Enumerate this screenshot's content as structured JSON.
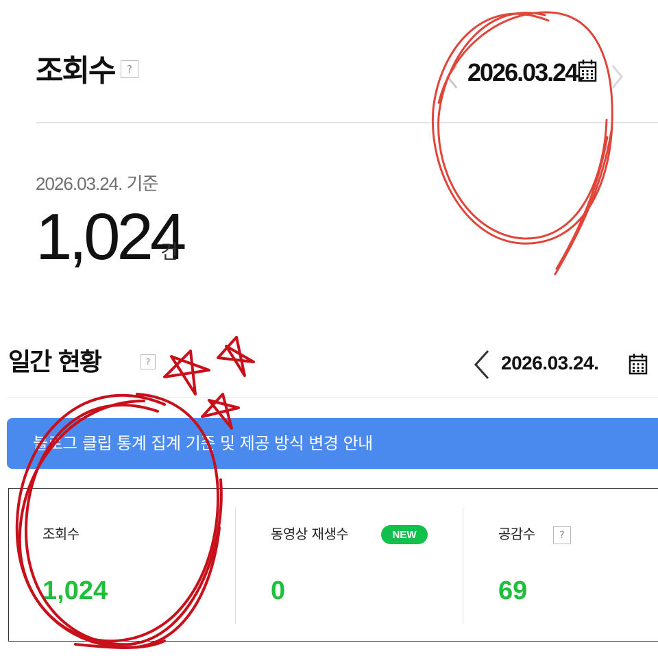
{
  "views_section": {
    "title": "조회수",
    "help_glyph": "?",
    "date": "2026.03.24.",
    "prev_icon": "chevron-left-icon",
    "next_icon": "chevron-right-icon",
    "calendar_icon": "calendar-icon",
    "basis_text": "2026.03.24. 기준",
    "total_value": "1,024",
    "total_unit": "건"
  },
  "daily_section": {
    "title": "일간 현황",
    "help_glyph": "?",
    "date": "2026.03.24.",
    "prev_icon": "chevron-left-icon",
    "calendar_icon": "calendar-icon",
    "notice": "블로그 클립 통계 집계 기준 및 제공 방식 변경 안내",
    "stats": [
      {
        "label": "조회수",
        "value": "1,024"
      },
      {
        "label": "동영상 재생수",
        "badge": "NEW",
        "value": "0"
      },
      {
        "label": "공감수",
        "help_glyph": "?",
        "value": "69"
      }
    ]
  },
  "colors": {
    "notice_bg": "#4a89ee",
    "stat_value": "#1fbf3a",
    "new_badge": "#12c04c",
    "annotation_red": "#d9261c"
  }
}
